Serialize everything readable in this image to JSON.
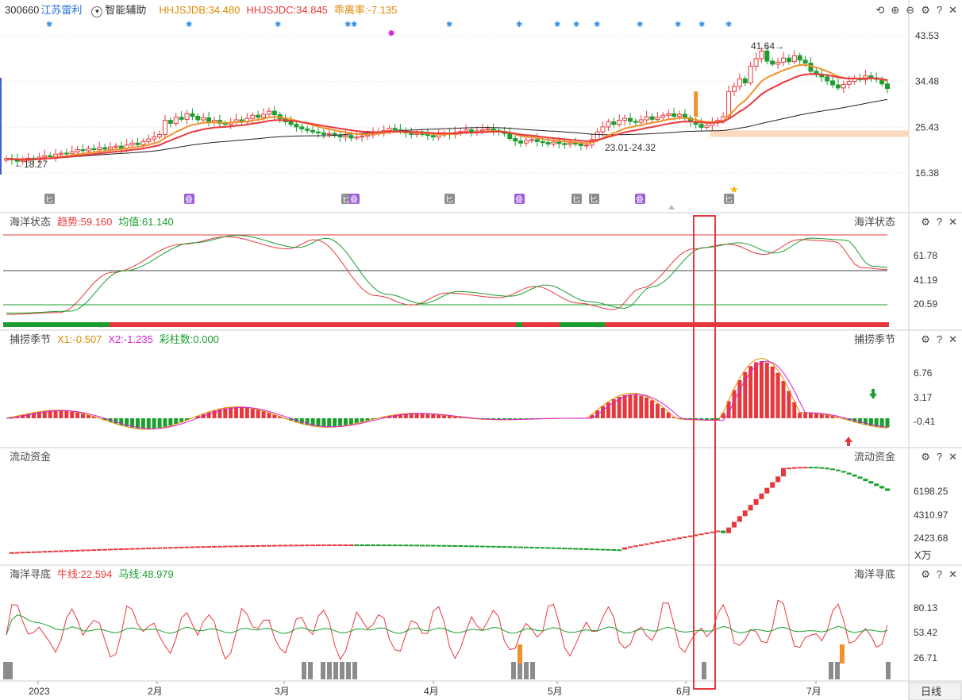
{
  "header": {
    "code": "300660",
    "name": "江苏雷利",
    "assist_label": "智能辅助",
    "hhjsjdb": "HHJSJDB:34.480",
    "hhjsjdc": "HHJSJDC:34.845",
    "deviation": "乖离率:-7.135",
    "colors": {
      "hhjsjdb": "#e08a00",
      "hhjsjdc": "#e8383d",
      "deviation": "#e08a00"
    }
  },
  "controls": {
    "refresh_icon": "refresh-icon",
    "zoom_in_icon": "zoom-in-icon",
    "zoom_out_icon": "zoom-out-icon",
    "gear_icon": "gear-icon",
    "help_icon": "help-icon",
    "close_icon": "close-icon"
  },
  "panels": {
    "main": {
      "labels": [
        "43.53",
        "34.48",
        "25.43",
        "16.38"
      ],
      "annot_high": "41.64",
      "annot_low": "18.27",
      "annot_range": "23.01-24.32"
    },
    "ocean": {
      "title": "海洋状态",
      "trend": "趋势:59.160",
      "mean": "均值:61.140",
      "labels": [
        "61.78",
        "41.19",
        "20.59"
      ]
    },
    "season": {
      "title": "捕捞季节",
      "x1": "X1:-0.507",
      "x2": "X2:-1.235",
      "bars": "彩柱数:0.000",
      "labels": [
        "6.76",
        "3.17",
        "-0.41"
      ]
    },
    "flow": {
      "title": "流动资金",
      "labels": [
        "6198.25",
        "4310.97",
        "2423.68"
      ],
      "unit": "X万"
    },
    "bottom": {
      "title": "海洋寻底",
      "bull": "牛线:22.594",
      "horse": "马线:48.979",
      "labels": [
        "80.13",
        "53.42",
        "26.71"
      ]
    }
  },
  "xaxis": {
    "labels": [
      "2023",
      "2月",
      "3月",
      "4月",
      "5月",
      "6月",
      "7月"
    ],
    "period_button": "日线"
  },
  "badges": {
    "expand": "匕",
    "overlay": "叠"
  },
  "colors": {
    "up": "#e8383d",
    "down": "#1a9e2e",
    "ma_orange": "#f0922b",
    "ma_red": "#e8383d",
    "ma_black": "#222222",
    "highlight": "#e8383d"
  },
  "chart_data": [
    {
      "type": "candlestick",
      "title": "300660 江苏雷利 日线",
      "x": [
        "2023",
        "2月",
        "3月",
        "4月",
        "5月",
        "6月",
        "7月"
      ],
      "ylim": [
        16.38,
        43.53
      ],
      "ticks": [
        43.53,
        34.48,
        25.43,
        16.38
      ],
      "annotations": [
        "41.64",
        "18.27",
        "23.01-24.32"
      ],
      "series": [
        {
          "name": "HHJSJDB",
          "values": [
            34.48
          ]
        },
        {
          "name": "HHJSJDC",
          "values": [
            34.845
          ]
        },
        {
          "name": "乖离率",
          "values": [
            -7.135
          ]
        }
      ],
      "closes": [
        19.2,
        19.0,
        18.7,
        18.9,
        19.3,
        19.0,
        19.5,
        19.8,
        19.6,
        20.1,
        20.3,
        20.2,
        20.6,
        21.0,
        20.8,
        21.2,
        21.0,
        21.4,
        21.1,
        21.5,
        21.7,
        21.3,
        21.9,
        22.3,
        22.0,
        22.6,
        23.1,
        23.5,
        24.0,
        26.8,
        26.2,
        27.4,
        27.0,
        28.1,
        27.6,
        26.9,
        27.3,
        26.5,
        26.8,
        26.2,
        26.0,
        26.4,
        26.9,
        26.5,
        27.2,
        27.8,
        27.4,
        28.0,
        28.6,
        27.9,
        27.1,
        26.5,
        26.0,
        25.5,
        25.1,
        24.8,
        24.5,
        24.3,
        24.0,
        24.2,
        23.8,
        23.5,
        23.8,
        23.3,
        23.5,
        23.7,
        23.9,
        24.2,
        24.5,
        24.8,
        25.2,
        24.9,
        24.6,
        24.3,
        24.0,
        24.2,
        24.0,
        23.8,
        23.5,
        23.9,
        24.2,
        24.0,
        24.4,
        24.6,
        24.9,
        24.5,
        24.7,
        24.9,
        25.1,
        24.8,
        24.6,
        24.2,
        23.2,
        22.7,
        22.3,
        22.8,
        23.0,
        22.6,
        22.4,
        22.1,
        22.5,
        22.2,
        22.0,
        22.3,
        22.1,
        21.8,
        21.9,
        23.0,
        24.5,
        25.5,
        26.5,
        26.0,
        26.8,
        27.2,
        26.6,
        26.4,
        26.9,
        27.5,
        27.0,
        27.4,
        27.8,
        28.1,
        27.6,
        28.0,
        27.3,
        26.5,
        26.0,
        25.4,
        25.8,
        26.3,
        26.8,
        27.5,
        32.5,
        33.5,
        35.0,
        34.2,
        37.5,
        39.0,
        40.5,
        38.5,
        37.9,
        38.3,
        39.1,
        38.4,
        39.6,
        38.7,
        38.1,
        36.5,
        35.8,
        35.4,
        34.6,
        33.8,
        33.2,
        33.9,
        34.5,
        35.1,
        34.8,
        35.6,
        35.2,
        34.9,
        34.0,
        33.1
      ]
    },
    {
      "type": "line",
      "title": "海洋状态",
      "ylim": [
        0,
        100
      ],
      "ticks": [
        61.78,
        41.19,
        20.59
      ],
      "series": [
        {
          "name": "趋势",
          "values": [
            59.16
          ]
        },
        {
          "name": "均值",
          "values": [
            61.14
          ]
        }
      ]
    },
    {
      "type": "bar",
      "title": "捕捞季节",
      "ticks": [
        6.76,
        3.17,
        -0.41
      ],
      "series": [
        {
          "name": "X1",
          "values": [
            -0.507
          ]
        },
        {
          "name": "X2",
          "values": [
            -1.235
          ]
        },
        {
          "name": "彩柱数",
          "values": [
            0.0
          ]
        }
      ]
    },
    {
      "type": "scatter",
      "title": "流动资金",
      "ylabel": "X万",
      "ticks": [
        6198.25,
        4310.97,
        2423.68
      ]
    },
    {
      "type": "line",
      "title": "海洋寻底",
      "ticks": [
        80.13,
        53.42,
        26.71
      ],
      "series": [
        {
          "name": "牛线",
          "values": [
            22.594
          ]
        },
        {
          "name": "马线",
          "values": [
            48.979
          ]
        }
      ]
    }
  ]
}
